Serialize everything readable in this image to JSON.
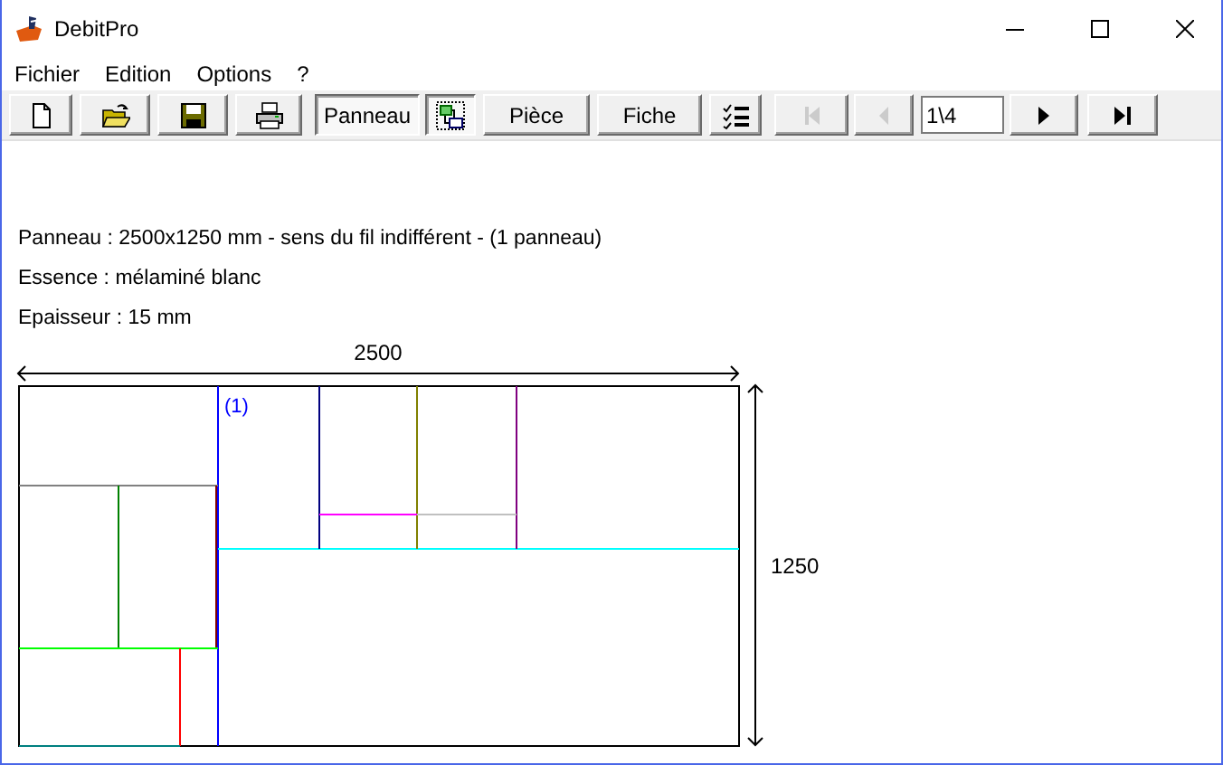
{
  "window": {
    "title": "DebitPro"
  },
  "menu": [
    "Fichier",
    "Edition",
    "Options",
    "?"
  ],
  "toolbar": [
    {
      "kind": "icon",
      "selected": false,
      "disabled": false
    },
    {
      "kind": "icon",
      "selected": false,
      "disabled": false
    },
    {
      "kind": "icon",
      "selected": false,
      "disabled": false
    },
    {
      "kind": "icon",
      "selected": false,
      "disabled": false
    },
    {
      "kind": "text",
      "label": "Panneau",
      "selected": true,
      "disabled": false
    },
    {
      "kind": "icon",
      "selected": true,
      "disabled": false
    },
    {
      "kind": "text",
      "label": "Pièce",
      "selected": false,
      "disabled": false
    },
    {
      "kind": "text",
      "label": "Fiche",
      "selected": false,
      "disabled": false
    },
    {
      "kind": "icon",
      "selected": false,
      "disabled": false
    },
    {
      "kind": "icon",
      "selected": false,
      "disabled": true
    },
    {
      "kind": "icon",
      "selected": false,
      "disabled": true
    },
    {
      "kind": "field",
      "value": "1\\4"
    },
    {
      "kind": "icon",
      "selected": false,
      "disabled": false
    },
    {
      "kind": "icon",
      "selected": false,
      "disabled": false
    }
  ],
  "info": [
    "Panneau : 2500x1250 mm - sens du fil indifférent - (1 panneau)",
    "Essence : mélaminé blanc",
    "Epaisseur : 15 mm"
  ],
  "diagram": {
    "width_label": "2500",
    "height_label": "1250",
    "panel_number": "(1)"
  }
}
